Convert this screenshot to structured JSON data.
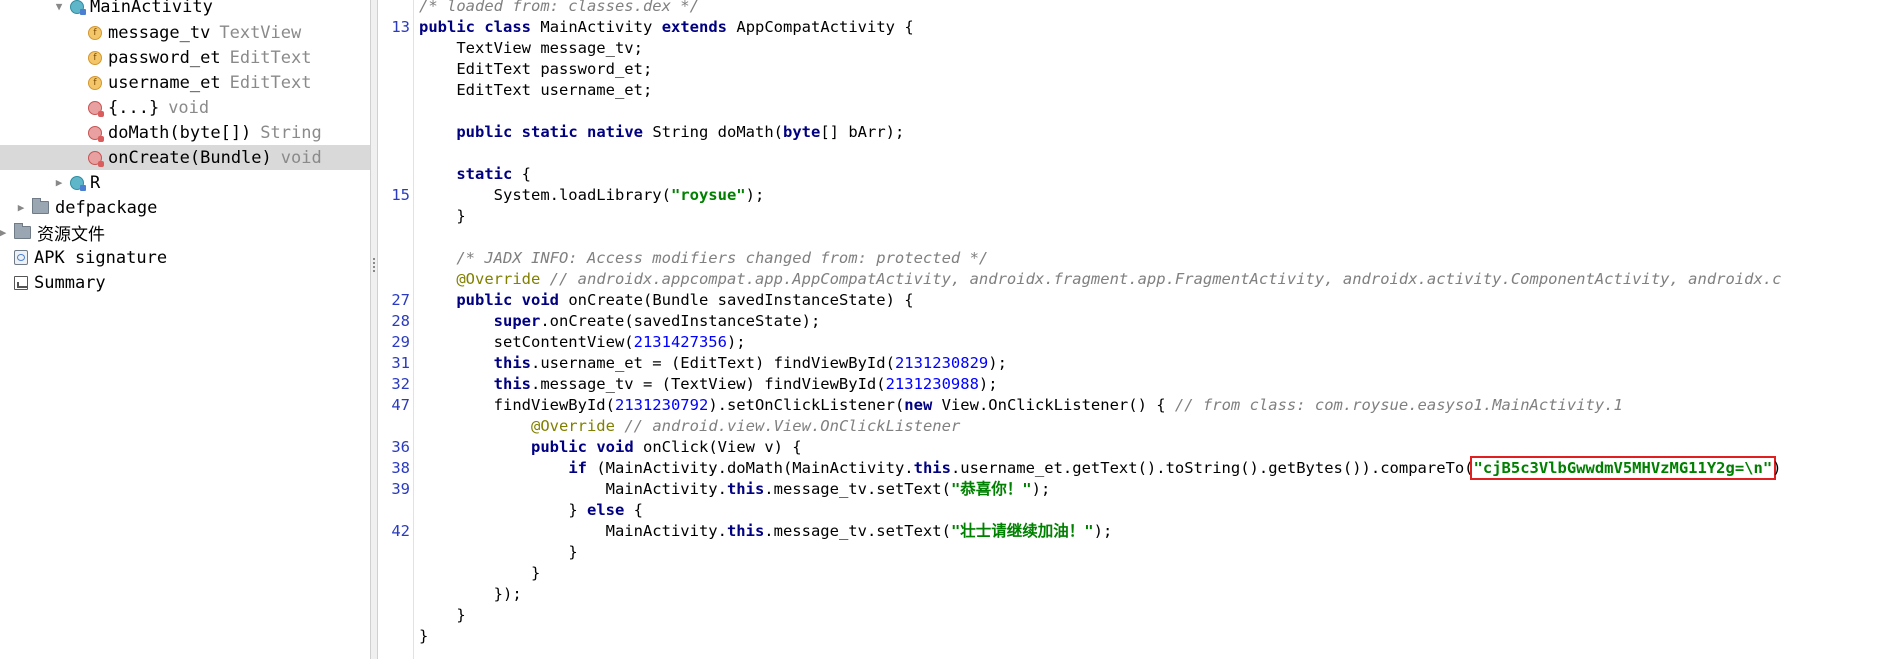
{
  "tree": {
    "main_activity": "MainActivity",
    "fields": [
      {
        "name": "message_tv",
        "type": "TextView"
      },
      {
        "name": "password_et",
        "type": "EditText"
      },
      {
        "name": "username_et",
        "type": "EditText"
      }
    ],
    "methods": [
      {
        "name": "{...}",
        "type": "void"
      },
      {
        "name": "doMath(byte[])",
        "type": "String"
      },
      {
        "name": "onCreate(Bundle)",
        "type": "void"
      }
    ],
    "r_class": "R",
    "defpackage": "defpackage",
    "resources": "资源文件",
    "apk_signature": "APK signature",
    "summary": "Summary"
  },
  "gutter": [
    "13",
    "15",
    "27",
    "28",
    "29",
    "31",
    "32",
    "47",
    "36",
    "38",
    "39",
    "42"
  ],
  "code": {
    "c0": "/* loaded from: classes.dex */",
    "l1": [
      "public",
      "class",
      "MainActivity",
      "extends",
      "AppCompatActivity {"
    ],
    "f1": "    TextView message_tv;",
    "f2": "    EditText password_et;",
    "f3": "    EditText username_et;",
    "n1": [
      "public",
      "static",
      "native",
      "String doMath(",
      "byte",
      "[] bArr);"
    ],
    "s1": [
      "static",
      "{"
    ],
    "s2": [
      "System.loadLibrary(",
      "\"roysue\"",
      ");"
    ],
    "s3": "}",
    "c1": "/* JADX INFO: Access modifiers changed from: protected */",
    "o1": [
      "@Override",
      "// androidx.appcompat.app.AppCompatActivity, androidx.fragment.app.FragmentActivity, androidx.activity.ComponentActivity, androidx.c"
    ],
    "m1": [
      "public",
      "void",
      "onCreate(Bundle savedInstanceState) {"
    ],
    "m2": [
      "super",
      ".onCreate(savedInstanceState);"
    ],
    "m3": [
      "setContentView(",
      "2131427356",
      ");"
    ],
    "m4": [
      "this",
      ".username_et = (EditText) findViewById(",
      "2131230829",
      ");"
    ],
    "m5": [
      "this",
      ".message_tv = (TextView) findViewById(",
      "2131230988",
      ");"
    ],
    "m6": [
      "findViewById(",
      "2131230792",
      ").setOnClickListener(",
      "new",
      "View.OnClickListener() { ",
      "// from class: com.roysue.easyso1.MainActivity.1"
    ],
    "m7": [
      "@Override",
      "// android.view.View.OnClickListener"
    ],
    "m8": [
      "public",
      "void",
      "onClick(View v) {"
    ],
    "m9": [
      "if",
      "(MainActivity.doMath(MainActivity.",
      "this",
      ".username_et.getText().toString().getBytes()).compareTo(",
      "\"cjB5c3VlbGwwdmV5MHVzMG11Y2g=\\n\"",
      ")"
    ],
    "m10": [
      "MainActivity.",
      "this",
      ".message_tv.setText(",
      "\"恭喜你！\"",
      ");"
    ],
    "m11": [
      "} ",
      "else",
      " {"
    ],
    "m12": [
      "MainActivity.",
      "this",
      ".message_tv.setText(",
      "\"壮士请继续加油！\"",
      ");"
    ],
    "m13": "}",
    "m14": "}",
    "m15": "});",
    "m16": "}",
    "m17": "}"
  }
}
